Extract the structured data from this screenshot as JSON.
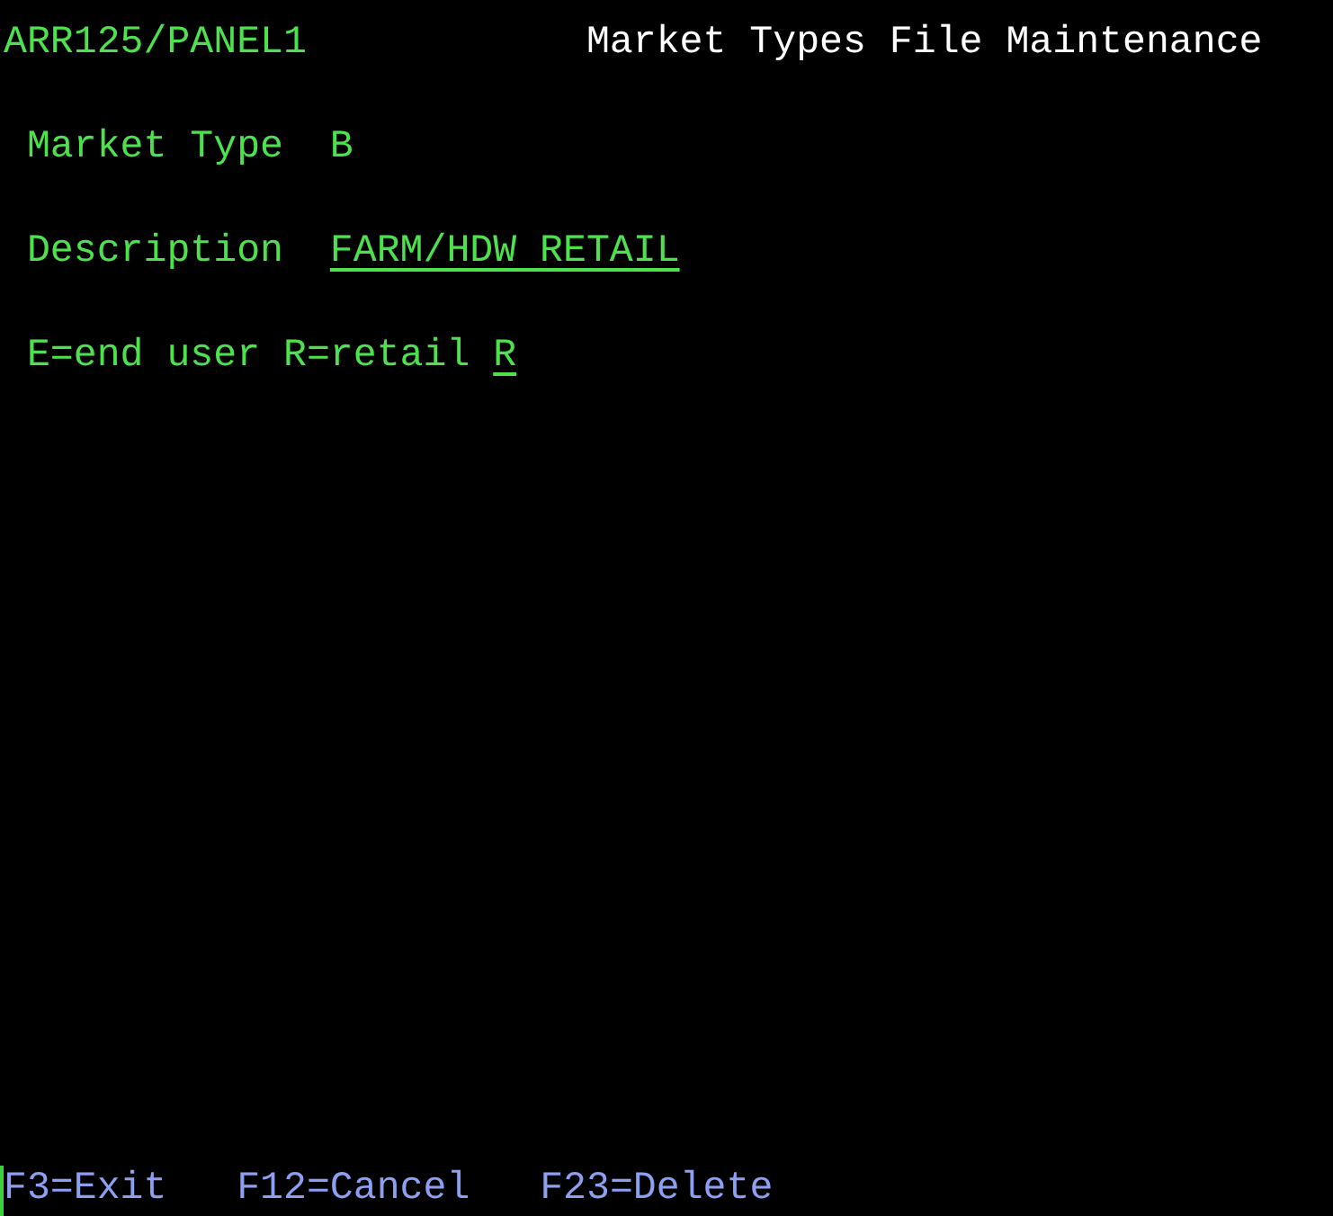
{
  "header": {
    "program": "ARR125/PANEL1",
    "title": "Market Types File Maintenance"
  },
  "fields": [
    {
      "label": "Market Type",
      "value": "B",
      "kind": "output"
    },
    {
      "label": "Description",
      "value": "FARM/HDW RETAIL",
      "kind": "input"
    },
    {
      "label": "E=end user R=retail",
      "value": "R",
      "kind": "input"
    }
  ],
  "function_keys": [
    "F3=Exit",
    "F12=Cancel",
    "F23=Delete"
  ]
}
